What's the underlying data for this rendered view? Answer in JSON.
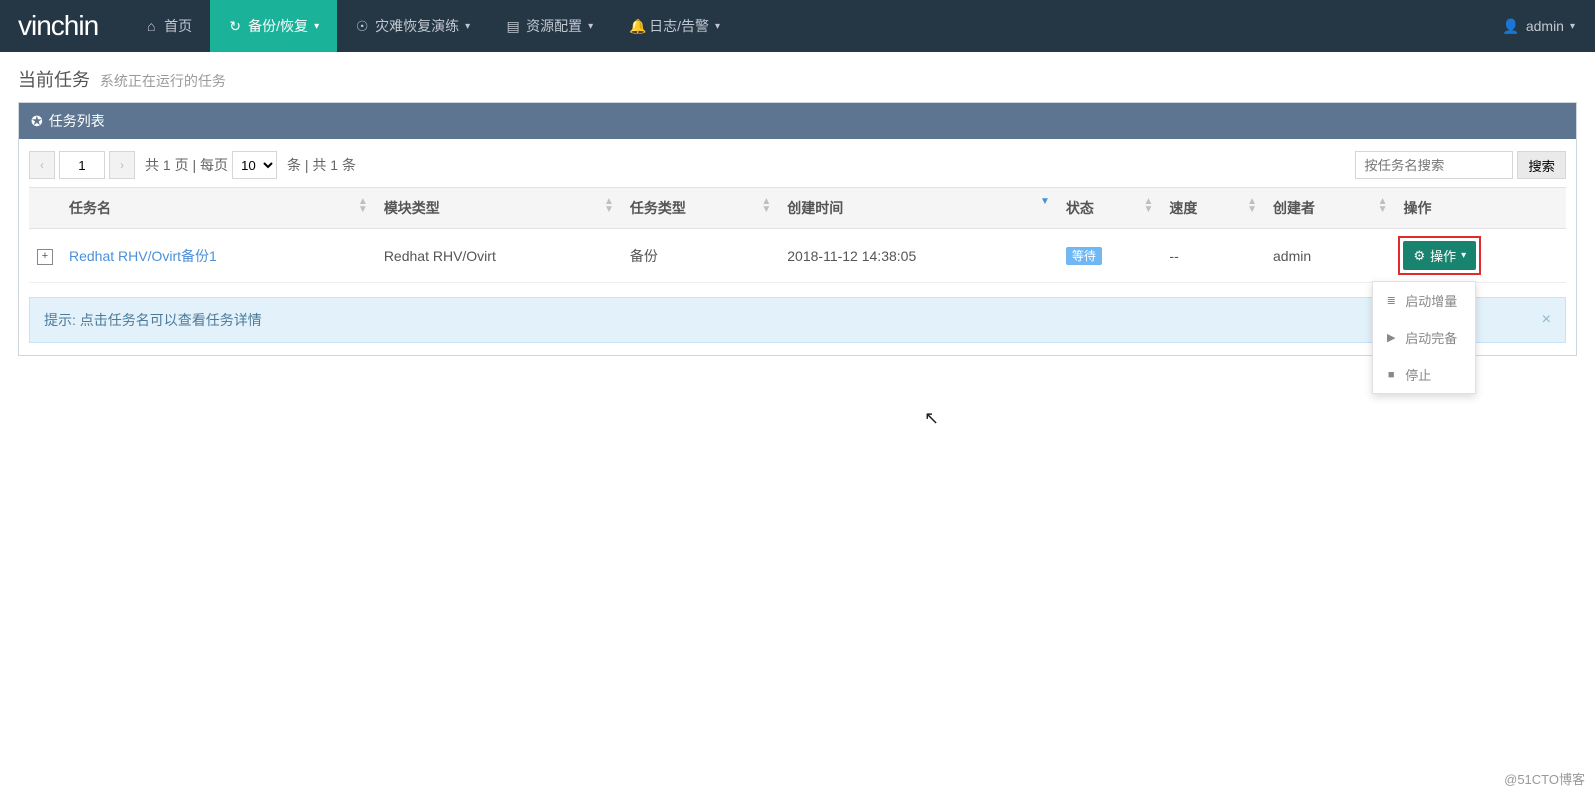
{
  "logo": "vinchin",
  "nav": {
    "items": [
      {
        "icon": "⌂",
        "label": "首页"
      },
      {
        "icon": "↻",
        "label": "备份/恢复",
        "caret": true,
        "active": true
      },
      {
        "icon": "☉",
        "label": "灾难恢复演练",
        "caret": true
      },
      {
        "icon": "▤",
        "label": "资源配置",
        "caret": true
      },
      {
        "icon": "🔔",
        "label": "日志/告警",
        "caret": true
      }
    ],
    "user": {
      "icon": "👤",
      "name": "admin"
    }
  },
  "page": {
    "title": "当前任务",
    "subtitle": "系统正在运行的任务"
  },
  "panel": {
    "icon": "✪",
    "title": "任务列表"
  },
  "pager": {
    "prev": "‹",
    "next": "›",
    "current": "1",
    "text_a": "共 1 页 | 每页",
    "per_page": "10",
    "text_b": "条 | 共 1 条"
  },
  "search": {
    "placeholder": "按任务名搜索",
    "button": "搜索"
  },
  "columns": [
    "任务名",
    "模块类型",
    "任务类型",
    "创建时间",
    "状态",
    "速度",
    "创建者",
    "操作"
  ],
  "row": {
    "task_name": "Redhat RHV/Ovirt备份1",
    "module": "Redhat RHV/Ovirt",
    "type": "备份",
    "created": "2018-11-12 14:38:05",
    "status": "等待",
    "speed": "--",
    "creator": "admin"
  },
  "op": {
    "icon": "⚙",
    "label": "操作",
    "caret": "▾",
    "menu": [
      {
        "icon": "≣",
        "label": "启动增量"
      },
      {
        "icon": "▶",
        "label": "启动完备"
      },
      {
        "icon": "■",
        "label": "停止"
      }
    ]
  },
  "hint": {
    "text": "提示: 点击任务名可以查看任务详情",
    "close": "×"
  },
  "watermark": "@51CTO博客"
}
